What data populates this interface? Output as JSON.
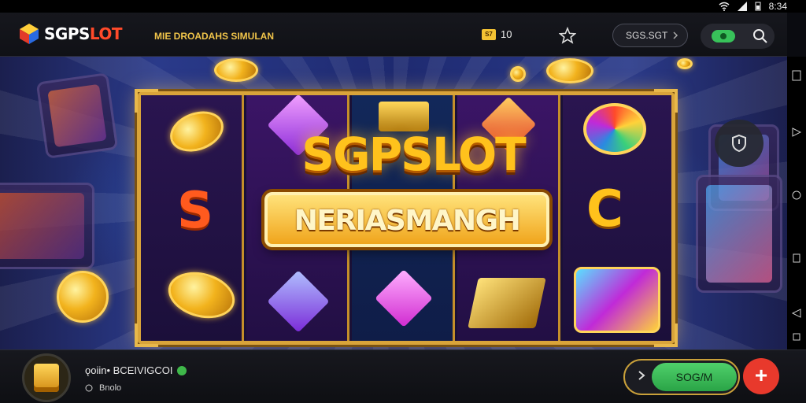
{
  "status_bar": {
    "time": "8:34"
  },
  "header": {
    "logo_part1": "SGPS",
    "logo_part2": "LOT",
    "subtitle": "MIE DROADAHS SIMULAN",
    "coin_icon_label": "S7",
    "coin_count": "10",
    "balance": "SGS.SGT"
  },
  "banner": {
    "title": "SGPSLOT",
    "subtitle": "NERIASMANGH",
    "reel_letters": [
      "S",
      "C"
    ]
  },
  "bottom": {
    "name": "ǫoiin• BCEIVIGCOI",
    "status": "Bnolo",
    "play_label": "SOG/M",
    "add_label": "+"
  },
  "colors": {
    "accent_gold": "#ffc21c",
    "play_green": "#2aa447",
    "add_red": "#e8392c",
    "logo_red": "#ff4a2a"
  },
  "icons": [
    "wifi-icon",
    "signal-icon",
    "battery-icon",
    "star-icon",
    "chevron-down-icon",
    "cash-icon",
    "search-icon",
    "shield-icon",
    "navigate-icon",
    "back-icon",
    "home-icon",
    "recent-icon",
    "notification-icon",
    "play-arrow-icon",
    "add-icon"
  ]
}
